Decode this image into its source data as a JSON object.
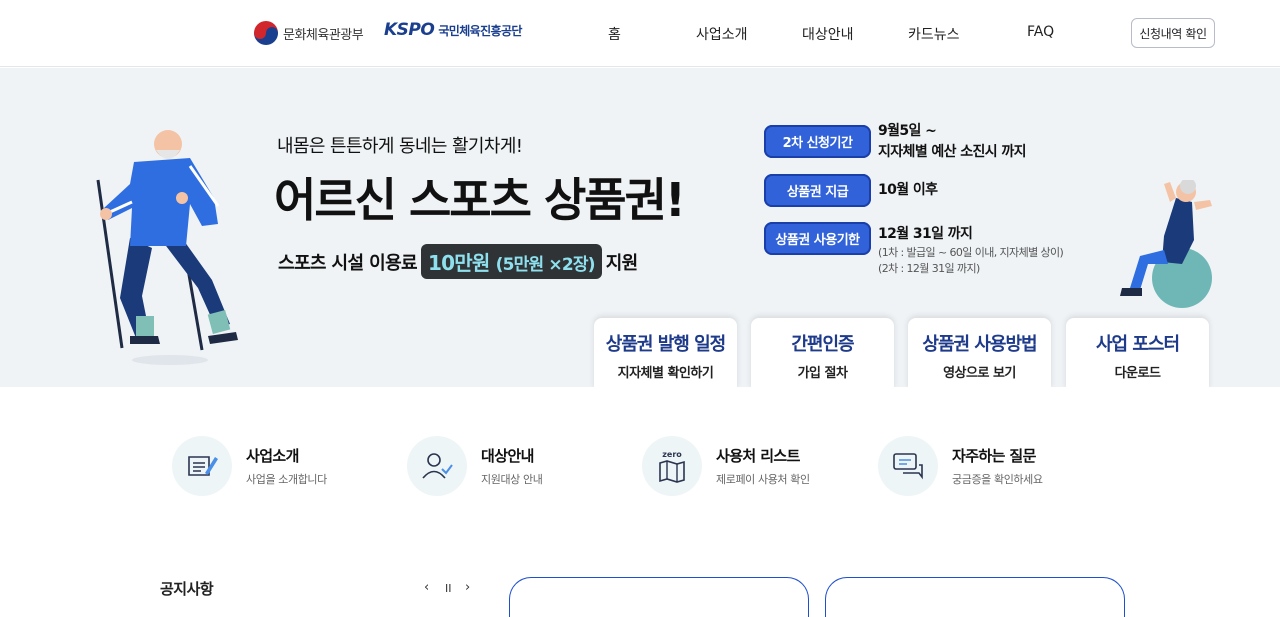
{
  "header": {
    "ministry_name": "문화체육관광부",
    "kspo_mark": "KSPO",
    "kspo_name": "국민체육진흥공단",
    "nav": [
      "홈",
      "사업소개",
      "대상안내",
      "카드뉴스",
      "FAQ"
    ],
    "apply_check_label": "신청내역 확인"
  },
  "hero": {
    "subtitle": "내몸은 튼튼하게 동네는 활기차게!",
    "title": "어르신 스포츠 상품권!",
    "support_prefix": "스포츠 시설 이용료",
    "amount_main": "10만원",
    "amount_detail": "(5만원 ×2장)",
    "support_suffix": "지원",
    "info": [
      {
        "badge": "2차 신청기간",
        "lines": [
          "9월5일 ~",
          "지자체별 예산 소진시 까지"
        ],
        "notes": []
      },
      {
        "badge": "상품권 지급",
        "lines": [
          "10월 이후"
        ],
        "notes": []
      },
      {
        "badge": "상품권 사용기한",
        "lines": [
          "12월 31일 까지"
        ],
        "notes": [
          "(1차 : 발급일 ~ 60일 이내, 지자체별 상이)",
          "(2차 : 12월 31일 까지)"
        ]
      }
    ],
    "tiles": [
      {
        "title": "상품권 발행 일정",
        "sub": "지자체별 확인하기"
      },
      {
        "title": "간편인증",
        "sub": "가입 절차"
      },
      {
        "title": "상품권 사용방법",
        "sub": "영상으로 보기"
      },
      {
        "title": "사업 포스터",
        "sub": "다운로드"
      }
    ]
  },
  "quick_links": [
    {
      "title": "사업소개",
      "desc": "사업을 소개합니다",
      "icon": "scroll-pen-icon"
    },
    {
      "title": "대상안내",
      "desc": "지원대상 안내",
      "icon": "user-check-icon"
    },
    {
      "title": "사용처 리스트",
      "desc": "제로페이 사용처 확인",
      "icon": "zero-map-icon",
      "icon_label": "zero"
    },
    {
      "title": "자주하는 질문",
      "desc": "궁금증을 확인하세요",
      "icon": "chat-bubbles-icon"
    }
  ],
  "notice": {
    "title": "공지사항",
    "prev": "‹",
    "pause": "II",
    "next": "›"
  },
  "colors": {
    "accent_blue": "#3162d9",
    "tile_title": "#1e3a8a",
    "hero_bg": "#eff3f6",
    "pill_text": "#8fe0ee"
  }
}
